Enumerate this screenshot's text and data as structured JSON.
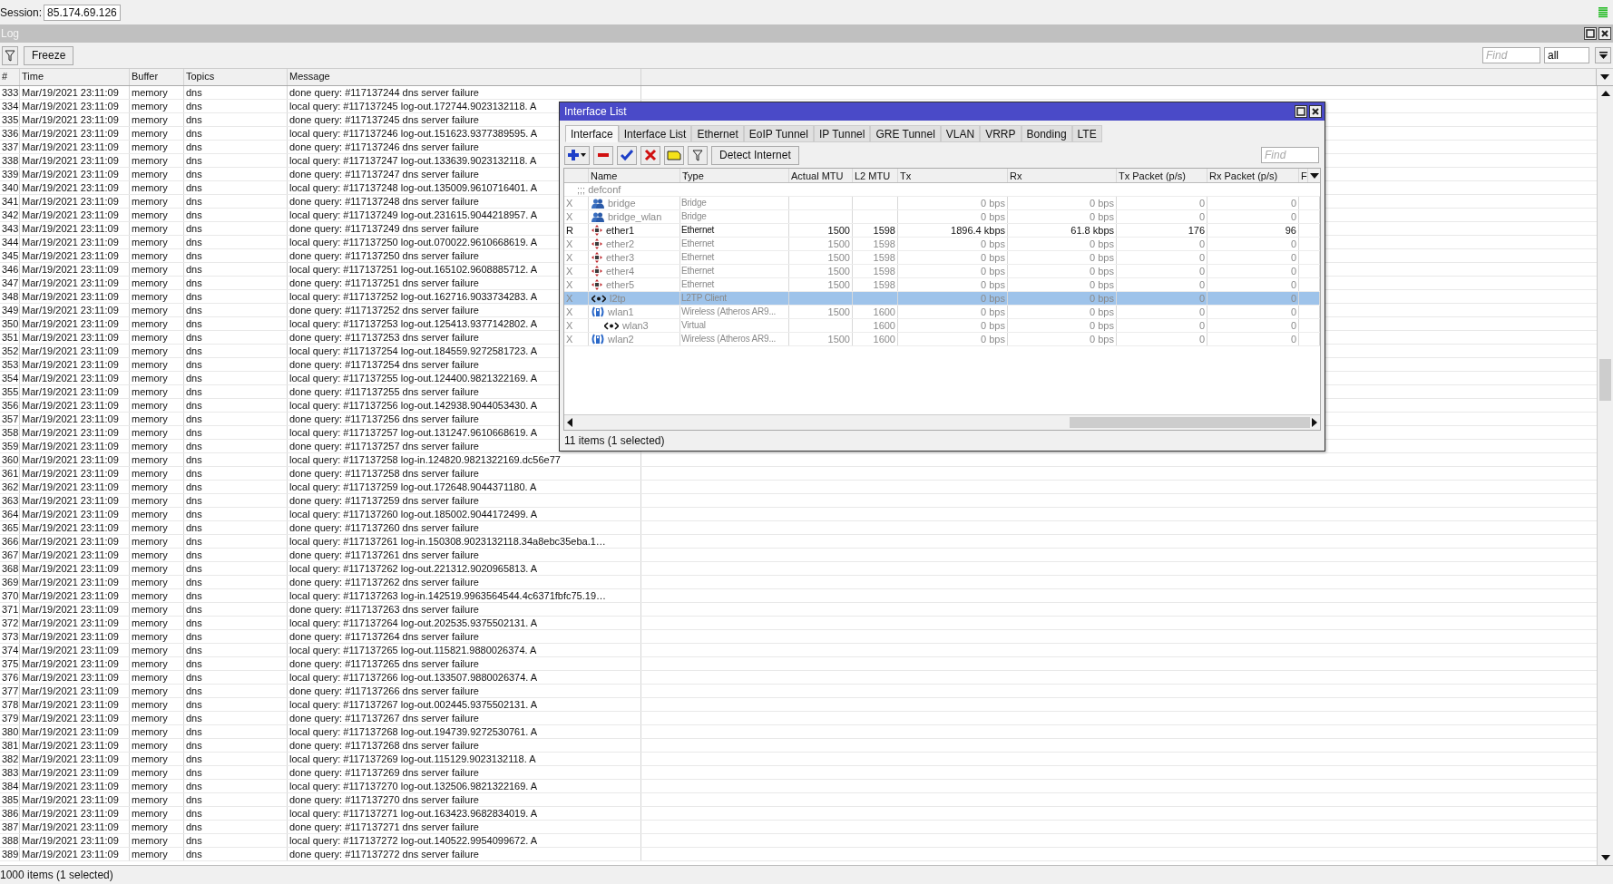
{
  "session": {
    "label": "Session:",
    "value": "85.174.69.126"
  },
  "log": {
    "title": "Log",
    "freeze": "Freeze",
    "find": {
      "placeholder": "Find"
    },
    "filter_value": "all",
    "columns": [
      "#",
      "Time",
      "Buffer",
      "Topics",
      "Message"
    ],
    "rows": [
      {
        "n": "333",
        "time": "Mar/19/2021 23:11:09",
        "buffer": "memory",
        "topics": "dns",
        "message": "done query: #117137244 dns server failure"
      },
      {
        "n": "334",
        "time": "Mar/19/2021 23:11:09",
        "buffer": "memory",
        "topics": "dns",
        "message": "local query: #117137245 log-out.172744.9023132118. A"
      },
      {
        "n": "335",
        "time": "Mar/19/2021 23:11:09",
        "buffer": "memory",
        "topics": "dns",
        "message": "done query: #117137245 dns server failure"
      },
      {
        "n": "336",
        "time": "Mar/19/2021 23:11:09",
        "buffer": "memory",
        "topics": "dns",
        "message": "local query: #117137246 log-out.151623.9377389595. A"
      },
      {
        "n": "337",
        "time": "Mar/19/2021 23:11:09",
        "buffer": "memory",
        "topics": "dns",
        "message": "done query: #117137246 dns server failure"
      },
      {
        "n": "338",
        "time": "Mar/19/2021 23:11:09",
        "buffer": "memory",
        "topics": "dns",
        "message": "local query: #117137247 log-out.133639.9023132118. A"
      },
      {
        "n": "339",
        "time": "Mar/19/2021 23:11:09",
        "buffer": "memory",
        "topics": "dns",
        "message": "done query: #117137247 dns server failure"
      },
      {
        "n": "340",
        "time": "Mar/19/2021 23:11:09",
        "buffer": "memory",
        "topics": "dns",
        "message": "local query: #117137248 log-out.135009.9610716401. A"
      },
      {
        "n": "341",
        "time": "Mar/19/2021 23:11:09",
        "buffer": "memory",
        "topics": "dns",
        "message": "done query: #117137248 dns server failure"
      },
      {
        "n": "342",
        "time": "Mar/19/2021 23:11:09",
        "buffer": "memory",
        "topics": "dns",
        "message": "local query: #117137249 log-out.231615.9044218957. A"
      },
      {
        "n": "343",
        "time": "Mar/19/2021 23:11:09",
        "buffer": "memory",
        "topics": "dns",
        "message": "done query: #117137249 dns server failure"
      },
      {
        "n": "344",
        "time": "Mar/19/2021 23:11:09",
        "buffer": "memory",
        "topics": "dns",
        "message": "local query: #117137250 log-out.070022.9610668619. A"
      },
      {
        "n": "345",
        "time": "Mar/19/2021 23:11:09",
        "buffer": "memory",
        "topics": "dns",
        "message": "done query: #117137250 dns server failure"
      },
      {
        "n": "346",
        "time": "Mar/19/2021 23:11:09",
        "buffer": "memory",
        "topics": "dns",
        "message": "local query: #117137251 log-out.165102.9608885712. A"
      },
      {
        "n": "347",
        "time": "Mar/19/2021 23:11:09",
        "buffer": "memory",
        "topics": "dns",
        "message": "done query: #117137251 dns server failure"
      },
      {
        "n": "348",
        "time": "Mar/19/2021 23:11:09",
        "buffer": "memory",
        "topics": "dns",
        "message": "local query: #117137252 log-out.162716.9033734283. A"
      },
      {
        "n": "349",
        "time": "Mar/19/2021 23:11:09",
        "buffer": "memory",
        "topics": "dns",
        "message": "done query: #117137252 dns server failure"
      },
      {
        "n": "350",
        "time": "Mar/19/2021 23:11:09",
        "buffer": "memory",
        "topics": "dns",
        "message": "local query: #117137253 log-out.125413.9377142802. A"
      },
      {
        "n": "351",
        "time": "Mar/19/2021 23:11:09",
        "buffer": "memory",
        "topics": "dns",
        "message": "done query: #117137253 dns server failure"
      },
      {
        "n": "352",
        "time": "Mar/19/2021 23:11:09",
        "buffer": "memory",
        "topics": "dns",
        "message": "local query: #117137254 log-out.184559.9272581723. A"
      },
      {
        "n": "353",
        "time": "Mar/19/2021 23:11:09",
        "buffer": "memory",
        "topics": "dns",
        "message": "done query: #117137254 dns server failure"
      },
      {
        "n": "354",
        "time": "Mar/19/2021 23:11:09",
        "buffer": "memory",
        "topics": "dns",
        "message": "local query: #117137255 log-out.124400.9821322169. A"
      },
      {
        "n": "355",
        "time": "Mar/19/2021 23:11:09",
        "buffer": "memory",
        "topics": "dns",
        "message": "done query: #117137255 dns server failure"
      },
      {
        "n": "356",
        "time": "Mar/19/2021 23:11:09",
        "buffer": "memory",
        "topics": "dns",
        "message": "local query: #117137256 log-out.142938.9044053430. A"
      },
      {
        "n": "357",
        "time": "Mar/19/2021 23:11:09",
        "buffer": "memory",
        "topics": "dns",
        "message": "done query: #117137256 dns server failure"
      },
      {
        "n": "358",
        "time": "Mar/19/2021 23:11:09",
        "buffer": "memory",
        "topics": "dns",
        "message": "local query: #117137257 log-out.131247.9610668619. A"
      },
      {
        "n": "359",
        "time": "Mar/19/2021 23:11:09",
        "buffer": "memory",
        "topics": "dns",
        "message": "done query: #117137257 dns server failure"
      },
      {
        "n": "360",
        "time": "Mar/19/2021 23:11:09",
        "buffer": "memory",
        "topics": "dns",
        "message": "local query: #117137258 log-in.124820.9821322169.dc56e77"
      },
      {
        "n": "361",
        "time": "Mar/19/2021 23:11:09",
        "buffer": "memory",
        "topics": "dns",
        "message": "done query: #117137258 dns server failure"
      },
      {
        "n": "362",
        "time": "Mar/19/2021 23:11:09",
        "buffer": "memory",
        "topics": "dns",
        "message": "local query: #117137259 log-out.172648.9044371180. A"
      },
      {
        "n": "363",
        "time": "Mar/19/2021 23:11:09",
        "buffer": "memory",
        "topics": "dns",
        "message": "done query: #117137259 dns server failure"
      },
      {
        "n": "364",
        "time": "Mar/19/2021 23:11:09",
        "buffer": "memory",
        "topics": "dns",
        "message": "local query: #117137260 log-out.185002.9044172499. A"
      },
      {
        "n": "365",
        "time": "Mar/19/2021 23:11:09",
        "buffer": "memory",
        "topics": "dns",
        "message": "done query: #117137260 dns server failure"
      },
      {
        "n": "366",
        "time": "Mar/19/2021 23:11:09",
        "buffer": "memory",
        "topics": "dns",
        "message": "local query: #117137261 log-in.150308.9023132118.34a8ebc35eba.1…"
      },
      {
        "n": "367",
        "time": "Mar/19/2021 23:11:09",
        "buffer": "memory",
        "topics": "dns",
        "message": "done query: #117137261 dns server failure"
      },
      {
        "n": "368",
        "time": "Mar/19/2021 23:11:09",
        "buffer": "memory",
        "topics": "dns",
        "message": "local query: #117137262 log-out.221312.9020965813. A"
      },
      {
        "n": "369",
        "time": "Mar/19/2021 23:11:09",
        "buffer": "memory",
        "topics": "dns",
        "message": "done query: #117137262 dns server failure"
      },
      {
        "n": "370",
        "time": "Mar/19/2021 23:11:09",
        "buffer": "memory",
        "topics": "dns",
        "message": "local query: #117137263 log-in.142519.9963564544.4c6371fbfc75.19…"
      },
      {
        "n": "371",
        "time": "Mar/19/2021 23:11:09",
        "buffer": "memory",
        "topics": "dns",
        "message": "done query: #117137263 dns server failure"
      },
      {
        "n": "372",
        "time": "Mar/19/2021 23:11:09",
        "buffer": "memory",
        "topics": "dns",
        "message": "local query: #117137264 log-out.202535.9375502131. A"
      },
      {
        "n": "373",
        "time": "Mar/19/2021 23:11:09",
        "buffer": "memory",
        "topics": "dns",
        "message": "done query: #117137264 dns server failure"
      },
      {
        "n": "374",
        "time": "Mar/19/2021 23:11:09",
        "buffer": "memory",
        "topics": "dns",
        "message": "local query: #117137265 log-out.115821.9880026374. A"
      },
      {
        "n": "375",
        "time": "Mar/19/2021 23:11:09",
        "buffer": "memory",
        "topics": "dns",
        "message": "done query: #117137265 dns server failure"
      },
      {
        "n": "376",
        "time": "Mar/19/2021 23:11:09",
        "buffer": "memory",
        "topics": "dns",
        "message": "local query: #117137266 log-out.133507.9880026374. A"
      },
      {
        "n": "377",
        "time": "Mar/19/2021 23:11:09",
        "buffer": "memory",
        "topics": "dns",
        "message": "done query: #117137266 dns server failure"
      },
      {
        "n": "378",
        "time": "Mar/19/2021 23:11:09",
        "buffer": "memory",
        "topics": "dns",
        "message": "local query: #117137267 log-out.002445.9375502131. A"
      },
      {
        "n": "379",
        "time": "Mar/19/2021 23:11:09",
        "buffer": "memory",
        "topics": "dns",
        "message": "done query: #117137267 dns server failure"
      },
      {
        "n": "380",
        "time": "Mar/19/2021 23:11:09",
        "buffer": "memory",
        "topics": "dns",
        "message": "local query: #117137268 log-out.194739.9272530761. A"
      },
      {
        "n": "381",
        "time": "Mar/19/2021 23:11:09",
        "buffer": "memory",
        "topics": "dns",
        "message": "done query: #117137268 dns server failure"
      },
      {
        "n": "382",
        "time": "Mar/19/2021 23:11:09",
        "buffer": "memory",
        "topics": "dns",
        "message": "local query: #117137269 log-out.115129.9023132118. A"
      },
      {
        "n": "383",
        "time": "Mar/19/2021 23:11:09",
        "buffer": "memory",
        "topics": "dns",
        "message": "done query: #117137269 dns server failure"
      },
      {
        "n": "384",
        "time": "Mar/19/2021 23:11:09",
        "buffer": "memory",
        "topics": "dns",
        "message": "local query: #117137270 log-out.132506.9821322169. A"
      },
      {
        "n": "385",
        "time": "Mar/19/2021 23:11:09",
        "buffer": "memory",
        "topics": "dns",
        "message": "done query: #117137270 dns server failure"
      },
      {
        "n": "386",
        "time": "Mar/19/2021 23:11:09",
        "buffer": "memory",
        "topics": "dns",
        "message": "local query: #117137271 log-out.163423.9682834019. A"
      },
      {
        "n": "387",
        "time": "Mar/19/2021 23:11:09",
        "buffer": "memory",
        "topics": "dns",
        "message": "done query: #117137271 dns server failure"
      },
      {
        "n": "388",
        "time": "Mar/19/2021 23:11:09",
        "buffer": "memory",
        "topics": "dns",
        "message": "local query: #117137272 log-out.140522.9954099672. A"
      },
      {
        "n": "389",
        "time": "Mar/19/2021 23:11:09",
        "buffer": "memory",
        "topics": "dns",
        "message": "done query: #117137272 dns server failure"
      }
    ],
    "status": "1000 items (1 selected)"
  },
  "interface_window": {
    "title": "Interface List",
    "tabs": [
      {
        "label": "Interface",
        "selected": true
      },
      {
        "label": "Interface List",
        "selected": false
      },
      {
        "label": "Ethernet",
        "selected": false
      },
      {
        "label": "EoIP Tunnel",
        "selected": false
      },
      {
        "label": "IP Tunnel",
        "selected": false
      },
      {
        "label": "GRE Tunnel",
        "selected": false
      },
      {
        "label": "VLAN",
        "selected": false
      },
      {
        "label": "VRRP",
        "selected": false
      },
      {
        "label": "Bonding",
        "selected": false
      },
      {
        "label": "LTE",
        "selected": false
      }
    ],
    "toolbar": [
      {
        "kind": "add"
      },
      {
        "kind": "remove"
      },
      {
        "kind": "enable"
      },
      {
        "kind": "disable"
      },
      {
        "kind": "comment"
      },
      {
        "kind": "filter"
      }
    ],
    "detect_button": "Detect Internet",
    "find": {
      "placeholder": "Find"
    },
    "columns": [
      "Name",
      "Type",
      "Actual MTU",
      "L2 MTU",
      "Tx",
      "Rx",
      "Tx Packet (p/s)",
      "Rx Packet (p/s)",
      "F"
    ],
    "comment": ";;; defconf",
    "rows": [
      {
        "flag": "X",
        "kind": "bridge",
        "name": "bridge",
        "type": "Bridge",
        "tx": "0 bps",
        "rx": "0 bps",
        "tx_packet": "0",
        "rx_packet": "0",
        "disabled": true,
        "selected": false
      },
      {
        "flag": "X",
        "kind": "bridge",
        "name": "bridge_wlan",
        "type": "Bridge",
        "tx": "0 bps",
        "rx": "0 bps",
        "tx_packet": "0",
        "rx_packet": "0",
        "disabled": true,
        "selected": false
      },
      {
        "flag": "R",
        "kind": "ethernet",
        "name": "ether1",
        "type": "Ethernet",
        "actual_mtu": "1500",
        "l2_mtu": "1598",
        "tx": "1896.4 kbps",
        "rx": "61.8 kbps",
        "tx_packet": "176",
        "rx_packet": "96",
        "disabled": false,
        "selected": false
      },
      {
        "flag": "X",
        "kind": "ethernet",
        "name": "ether2",
        "type": "Ethernet",
        "actual_mtu": "1500",
        "l2_mtu": "1598",
        "tx": "0 bps",
        "rx": "0 bps",
        "tx_packet": "0",
        "rx_packet": "0",
        "disabled": true,
        "selected": false
      },
      {
        "flag": "X",
        "kind": "ethernet",
        "name": "ether3",
        "type": "Ethernet",
        "actual_mtu": "1500",
        "l2_mtu": "1598",
        "tx": "0 bps",
        "rx": "0 bps",
        "tx_packet": "0",
        "rx_packet": "0",
        "disabled": true,
        "selected": false
      },
      {
        "flag": "X",
        "kind": "ethernet",
        "name": "ether4",
        "type": "Ethernet",
        "actual_mtu": "1500",
        "l2_mtu": "1598",
        "tx": "0 bps",
        "rx": "0 bps",
        "tx_packet": "0",
        "rx_packet": "0",
        "disabled": true,
        "selected": false
      },
      {
        "flag": "X",
        "kind": "ethernet",
        "name": "ether5",
        "type": "Ethernet",
        "actual_mtu": "1500",
        "l2_mtu": "1598",
        "tx": "0 bps",
        "rx": "0 bps",
        "tx_packet": "0",
        "rx_packet": "0",
        "disabled": true,
        "selected": false
      },
      {
        "flag": "X",
        "kind": "tunnel",
        "name": "l2tp",
        "type": "L2TP Client",
        "tx": "0 bps",
        "rx": "0 bps",
        "tx_packet": "0",
        "rx_packet": "0",
        "disabled": true,
        "selected": true
      },
      {
        "flag": "X",
        "kind": "wireless",
        "name": "wlan1",
        "type": "Wireless (Atheros AR9...",
        "actual_mtu": "1500",
        "l2_mtu": "1600",
        "tx": "0 bps",
        "rx": "0 bps",
        "tx_packet": "0",
        "rx_packet": "0",
        "disabled": true,
        "selected": false,
        "children": [
          {
            "flag": "X",
            "kind": "tunnel",
            "name": "wlan3",
            "type": "Virtual",
            "l2_mtu": "1600",
            "tx": "0 bps",
            "rx": "0 bps",
            "tx_packet": "0",
            "rx_packet": "0",
            "disabled": true,
            "selected": false
          }
        ]
      },
      {
        "flag": "X",
        "kind": "wireless",
        "name": "wlan2",
        "type": "Wireless (Atheros AR9...",
        "actual_mtu": "1500",
        "l2_mtu": "1600",
        "tx": "0 bps",
        "rx": "0 bps",
        "tx_packet": "0",
        "rx_packet": "0",
        "disabled": true,
        "selected": false
      }
    ],
    "status": "11 items (1 selected)"
  }
}
